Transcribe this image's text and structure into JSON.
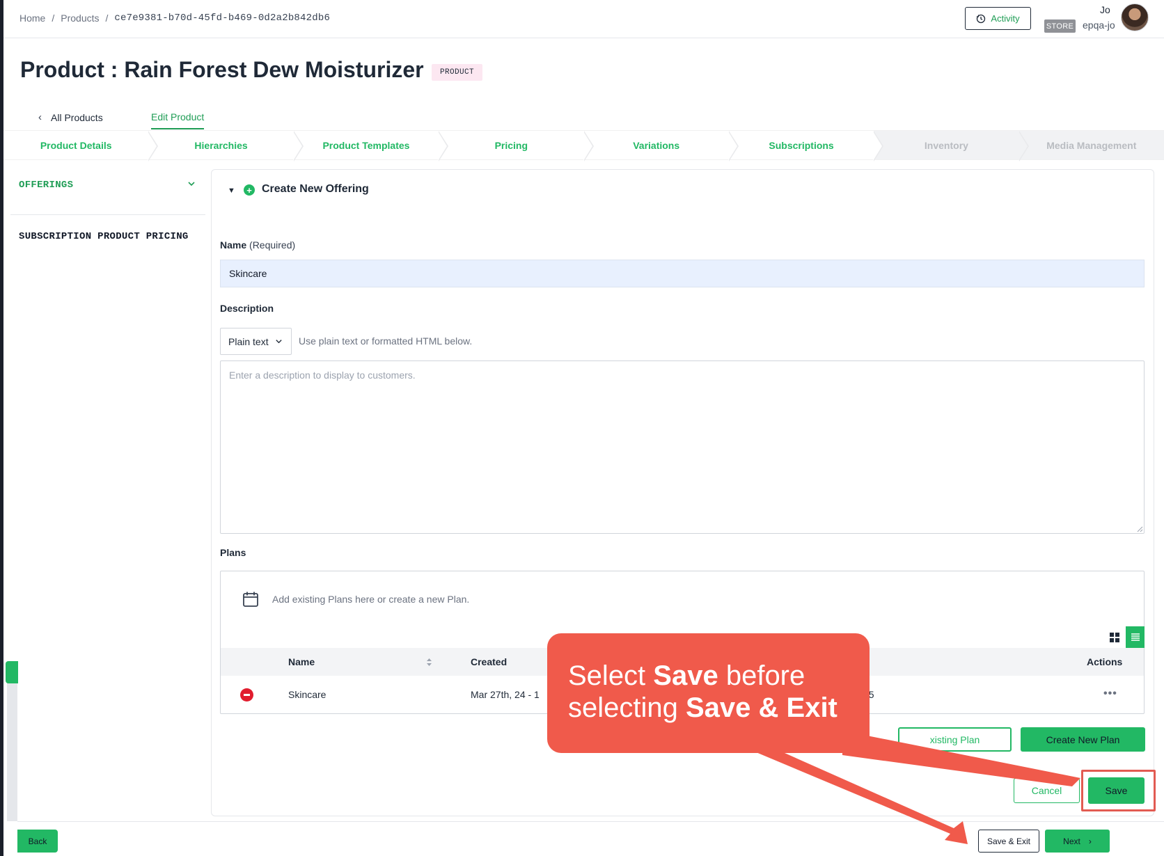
{
  "breadcrumb": {
    "home": "Home",
    "sep1": "/",
    "products": "Products",
    "sep2": "/",
    "current": "ce7e9381-b70d-45fd-b469-0d2a2b842db6"
  },
  "header": {
    "activity_label": "Activity",
    "store_badge": "STORE",
    "user_name": "Jo",
    "user_handle": "epqa-jo"
  },
  "page": {
    "title": "Product : Rain Forest Dew Moisturizer",
    "type_badge": "PRODUCT"
  },
  "subnav": {
    "back_label": "All Products",
    "active_label": "Edit Product"
  },
  "steps": [
    {
      "label": "Product Details",
      "enabled": true
    },
    {
      "label": "Hierarchies",
      "enabled": true
    },
    {
      "label": "Product Templates",
      "enabled": true
    },
    {
      "label": "Pricing",
      "enabled": true
    },
    {
      "label": "Variations",
      "enabled": true
    },
    {
      "label": "Subscriptions",
      "enabled": true
    },
    {
      "label": "Inventory",
      "enabled": false
    },
    {
      "label": "Media Management",
      "enabled": false
    }
  ],
  "sidebar": {
    "offerings": "OFFERINGS",
    "subscription_pricing": "SUBSCRIPTION PRODUCT PRICING"
  },
  "offering_form": {
    "title": "Create New Offering",
    "name_label": "Name",
    "name_required": "(Required)",
    "name_value": "Skincare",
    "description_label": "Description",
    "format_value": "Plain text",
    "format_hint": "Use plain text or formatted HTML below.",
    "description_placeholder": "Enter a description to display to customers.",
    "plans_label": "Plans",
    "plans_hint": "Add existing Plans here or create a new Plan.",
    "table": {
      "headers": {
        "name": "Name",
        "created": "Created",
        "actions": "Actions"
      },
      "rows": [
        {
          "name": "Skincare",
          "created": "Mar 27th, 24 - 1",
          "trailing": "15"
        }
      ]
    },
    "add_existing_label": "xisting Plan",
    "create_plan_label": "Create New Plan",
    "cancel_label": "Cancel",
    "save_label": "Save"
  },
  "footer": {
    "back_label": "Back",
    "save_exit_label": "Save & Exit",
    "next_label": "Next"
  },
  "annotation": {
    "line1_pre": "Select ",
    "line1_bold": "Save",
    "line1_post": " before",
    "line2_pre": "selecting ",
    "line2_bold": "Save & Exit"
  },
  "colors": {
    "accent_green": "#22b864",
    "callout_red": "#f05a4b",
    "remove_red": "#e11d2e"
  }
}
